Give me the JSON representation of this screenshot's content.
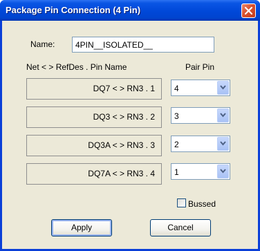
{
  "window": {
    "title": "Package Pin Connection (4 Pin)"
  },
  "name": {
    "label": "Name:",
    "value": "4PIN__ISOLATED__"
  },
  "headers": {
    "net_refdes": "Net <  > RefDes . Pin Name",
    "pair_pin": "Pair Pin"
  },
  "pins": [
    {
      "connection": "DQ7 <  > RN3 . 1",
      "pair": "4"
    },
    {
      "connection": "DQ3 <  > RN3 . 2",
      "pair": "3"
    },
    {
      "connection": "DQ3A <  > RN3 . 3",
      "pair": "2"
    },
    {
      "connection": "DQ7A <  > RN3 . 4",
      "pair": "1"
    }
  ],
  "bussed": {
    "label": "Bussed",
    "checked": false
  },
  "buttons": {
    "apply": "Apply",
    "cancel": "Cancel"
  },
  "colors": {
    "titlebar": "#0048d8",
    "client": "#ece9d8",
    "close": "#d9522f"
  }
}
